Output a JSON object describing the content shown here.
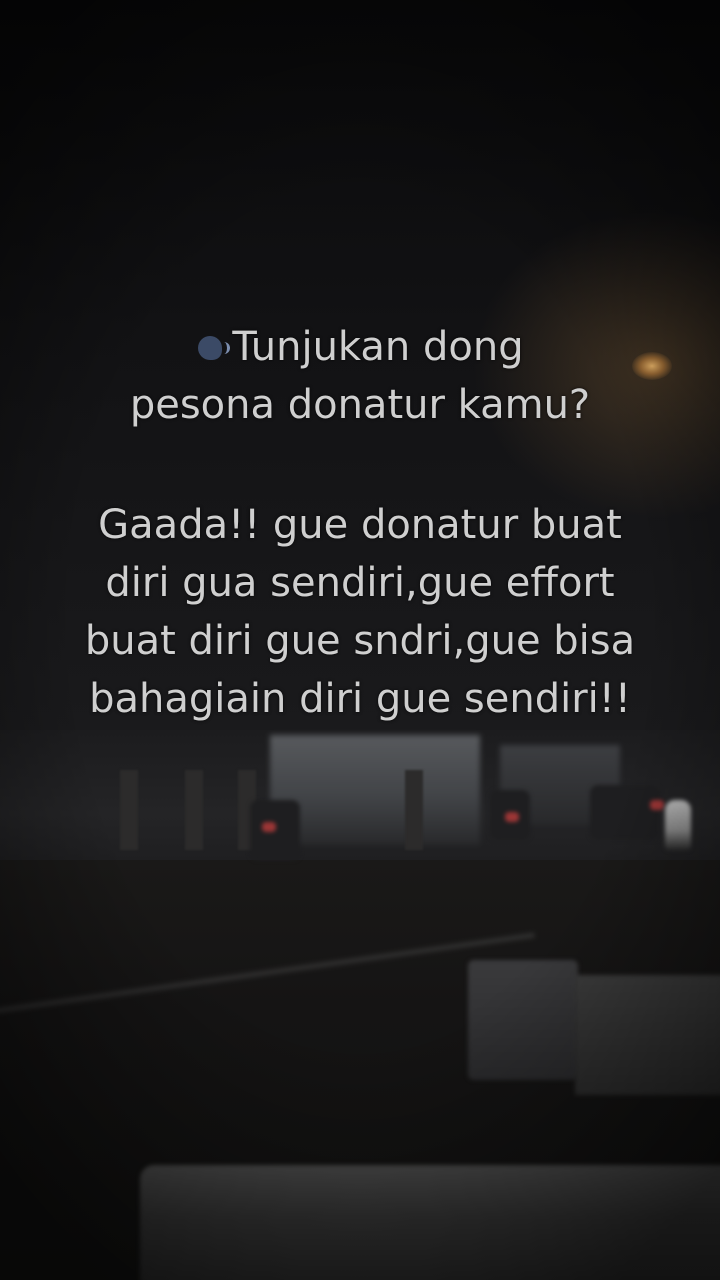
{
  "scene": {
    "description_icon": "speaking-head-icon",
    "caption_color": "#cfcfcf"
  },
  "caption": {
    "question_lines": [
      "Tunjukan dong",
      "pesona donatur kamu?"
    ],
    "answer_lines": [
      "Gaada!! gue donatur buat",
      "diri gua sendiri,gue effort",
      "buat diri gue sndri,gue bisa",
      "bahagiain diri gue sendiri!!"
    ]
  }
}
